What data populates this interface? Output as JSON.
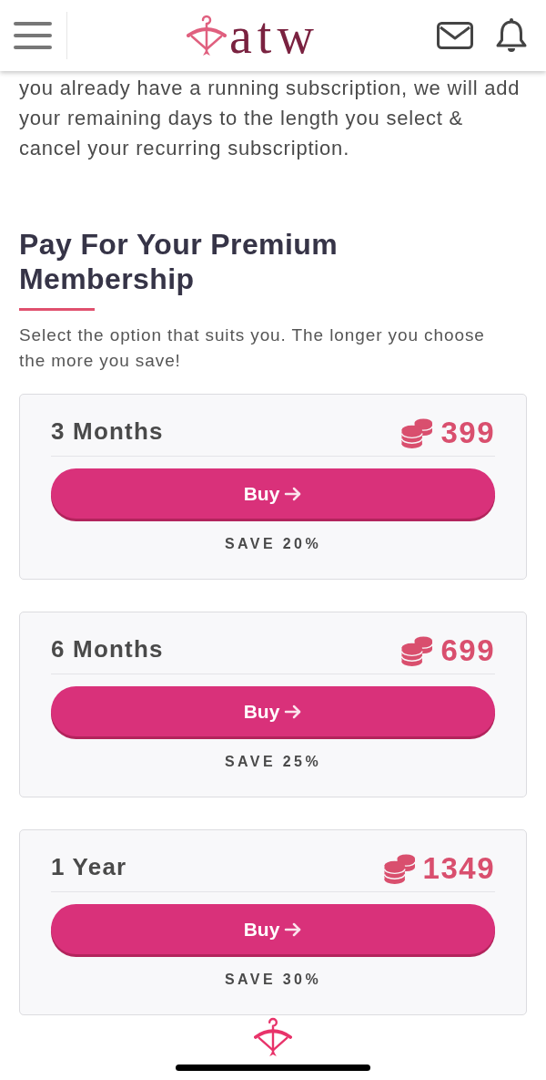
{
  "header": {
    "logo_text": "atw"
  },
  "intro": {
    "text": "you already have a running subscription, we will add your remaining days to the length you select & cancel your recurring subscription."
  },
  "section": {
    "title": "Pay For Your Premium Membership",
    "subtitle": "Select the option that suits you. The longer you choose the more you save!"
  },
  "plans": [
    {
      "name": "3 Months",
      "price": "399",
      "button": "Buy",
      "savings": "SAVE 20%"
    },
    {
      "name": "6 Months",
      "price": "699",
      "button": "Buy",
      "savings": "SAVE 25%"
    },
    {
      "name": "1 Year",
      "price": "1349",
      "button": "Buy",
      "savings": "SAVE 30%"
    }
  ]
}
